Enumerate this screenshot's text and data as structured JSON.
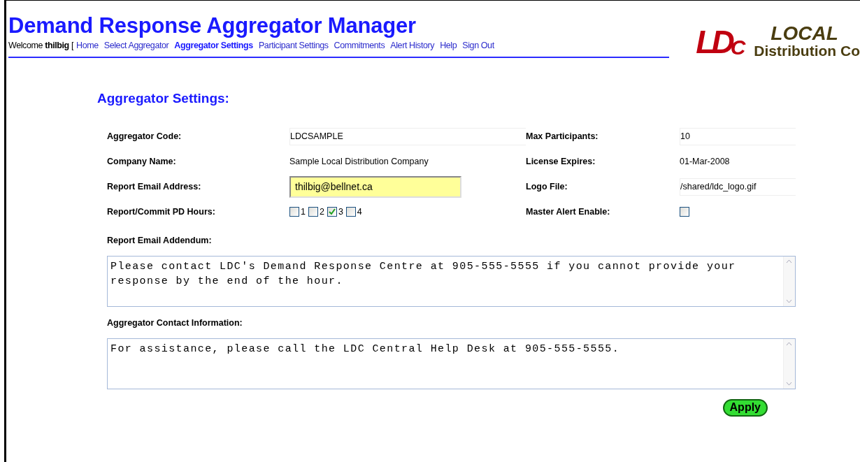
{
  "header": {
    "title": "Demand Response Aggregator Manager",
    "welcome": "Welcome",
    "user": "thilbig",
    "bracket": "[",
    "nav": [
      {
        "label": "Home",
        "selected": false
      },
      {
        "label": "Select Aggregator",
        "selected": false
      },
      {
        "label": "Aggregator Settings",
        "selected": true
      },
      {
        "label": "Participant Settings",
        "selected": false
      },
      {
        "label": "Commitments",
        "selected": false
      },
      {
        "label": "Alert History",
        "selected": false
      },
      {
        "label": "Help",
        "selected": false
      },
      {
        "label": "Sign Out",
        "selected": false
      }
    ],
    "logo": {
      "mark": [
        "L",
        "D",
        "C"
      ],
      "line_1": "LOCAL",
      "line_2": "Distribution Co"
    }
  },
  "heading": "Aggregator Settings:",
  "fields": [
    {
      "label": "Aggregator Code:",
      "kind": "input",
      "value": "LDCSAMPLE"
    },
    {
      "label": "Max Participants:",
      "kind": "input",
      "value": "10"
    },
    {
      "label": "Company Name:",
      "kind": "text",
      "value": "Sample Local Distribution Company"
    },
    {
      "label": "License Expires:",
      "kind": "text",
      "value": "01-Mar-2008"
    },
    {
      "label": "Report Email Address:",
      "kind": "highlight",
      "value": "thilbig@bellnet.ca"
    },
    {
      "label": "Logo File:",
      "kind": "input",
      "value": "/shared/ldc_logo.gif"
    },
    {
      "label": "Report/Commit PD Hours:",
      "kind": "checkboxes",
      "options": [
        {
          "label": "1",
          "checked": false
        },
        {
          "label": "2",
          "checked": false
        },
        {
          "label": "3",
          "checked": true
        },
        {
          "label": "4",
          "checked": false
        }
      ]
    },
    {
      "label": "Master Alert Enable:",
      "kind": "checkbox",
      "checked": false
    }
  ],
  "text_areas": [
    {
      "label": "Report Email Addendum:",
      "value": "Please contact LDC's Demand Response Centre at 905-555-5555 if you cannot provide your response by the end of the hour."
    },
    {
      "label": "Aggregator Contact Information:",
      "value": "For assistance, please call the LDC Central Help Desk at 905-555-5555."
    }
  ],
  "apply_button": "Apply"
}
